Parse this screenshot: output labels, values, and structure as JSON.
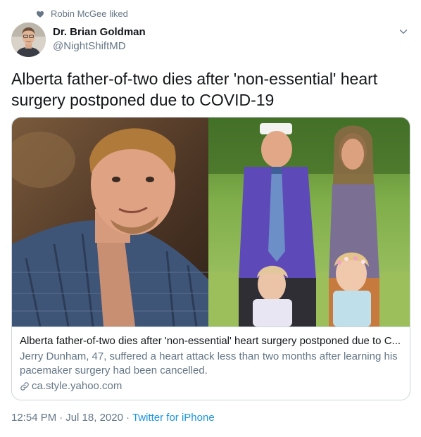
{
  "social_context": {
    "icon": "heart-icon",
    "text": "Robin McGee liked"
  },
  "author": {
    "display_name": "Dr. Brian Goldman",
    "handle": "@NightShiftMD",
    "avatar_icon": "avatar"
  },
  "tweet": {
    "text": "Alberta father-of-two dies after 'non-essential' heart surgery postponed due to COVID-19"
  },
  "card": {
    "title": "Alberta father-of-two dies after 'non-essential' heart surgery postponed due to C...",
    "description": "Jerry Dunham, 47, suffered a heart attack less than two months after learning his pacemaker surgery had been cancelled.",
    "domain": "ca.style.yahoo.com",
    "domain_icon": "link-icon"
  },
  "meta": {
    "time": "12:54 PM",
    "separator": "·",
    "date": "Jul 18, 2020",
    "source": "Twitter for iPhone"
  },
  "colors": {
    "text_primary": "#14171a",
    "text_secondary": "#657786",
    "link": "#1b95e0",
    "border": "#ccd6dd"
  }
}
